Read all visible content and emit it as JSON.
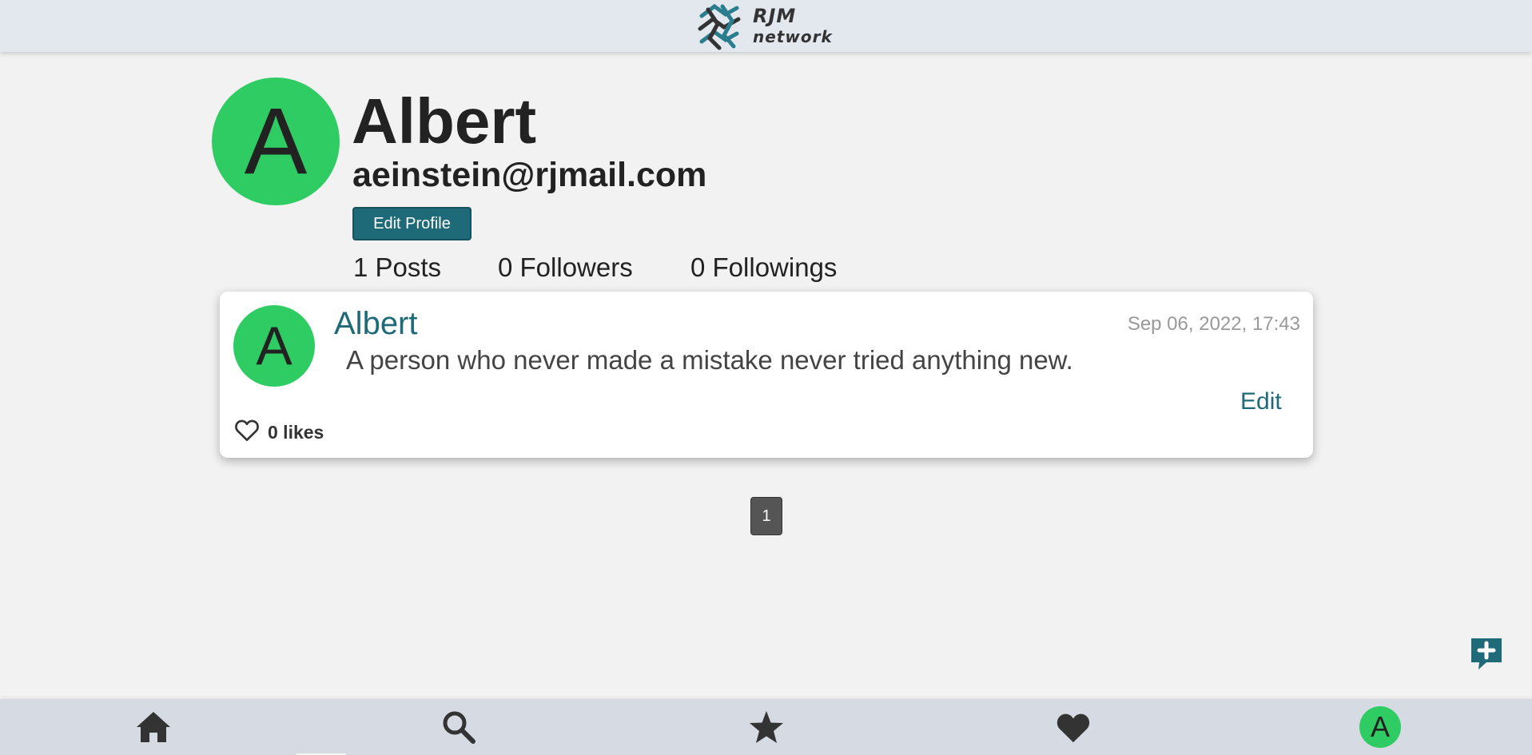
{
  "header": {
    "logo_line1": "RJM",
    "logo_line2": "network"
  },
  "profile": {
    "avatar_initial": "A",
    "name": "Albert",
    "email": "aeinstein@rjmail.com",
    "edit_button_label": "Edit Profile",
    "stats": {
      "posts": "1 Posts",
      "followers": "0 Followers",
      "followings": "0 Followings"
    }
  },
  "posts": [
    {
      "avatar_initial": "A",
      "author": "Albert",
      "date": "Sep 06, 2022, 17:43",
      "content": "A person who never made a mistake never tried anything new.",
      "edit_label": "Edit",
      "likes": "0 likes"
    }
  ],
  "pagination": {
    "current_page": "1"
  },
  "bottom_nav": {
    "items": [
      {
        "icon": "home-icon"
      },
      {
        "icon": "search-icon"
      },
      {
        "icon": "star-icon"
      },
      {
        "icon": "heart-icon"
      },
      {
        "icon": "avatar",
        "initial": "A"
      }
    ]
  },
  "colors": {
    "accent": "#1e6a78",
    "avatar_green": "#2ecc63",
    "header_bg": "#e3e7ee",
    "page_bg": "#f2f2f2",
    "nav_bg": "#d6dae2"
  }
}
